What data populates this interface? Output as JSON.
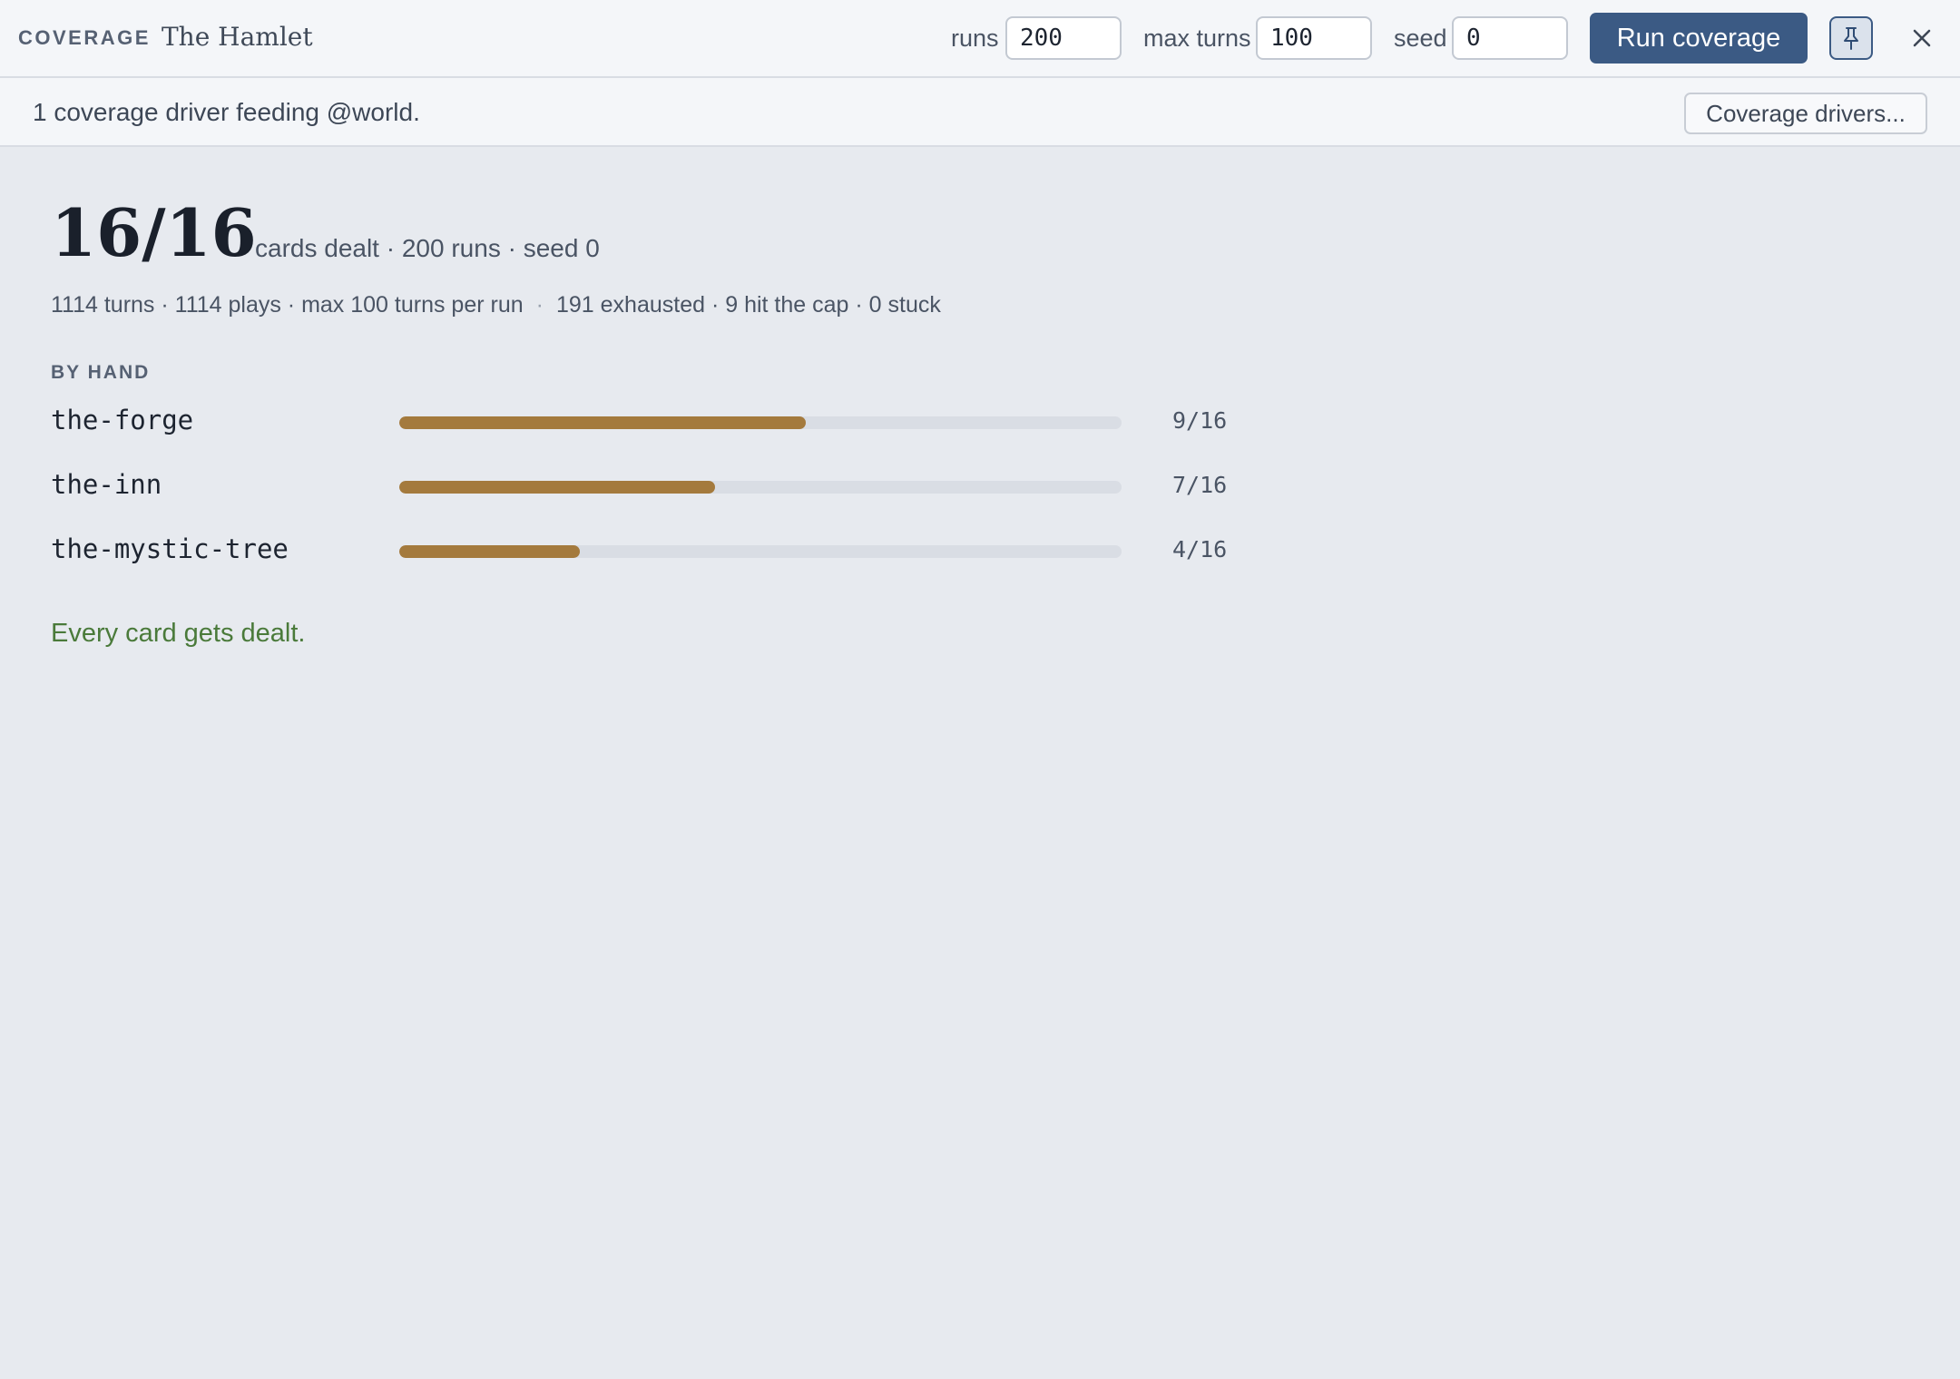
{
  "header": {
    "brand": "COVERAGE",
    "title": "The Hamlet",
    "runs_label": "runs",
    "runs_value": "200",
    "max_turns_label": "max turns",
    "max_turns_value": "100",
    "seed_label": "seed",
    "seed_value": "0",
    "run_button": "Run coverage",
    "pin_icon": "pin-icon",
    "close_icon": "close-icon"
  },
  "subbar": {
    "text": "1 coverage driver feeding @world.",
    "drivers_button": "Coverage drivers..."
  },
  "summary": {
    "count": "16/16",
    "caption": "cards dealt · 200 runs · seed 0",
    "stats_left": "1114 turns · 1114 plays · max 100 turns per run",
    "stats_sep": "·",
    "stats_right": "191 exhausted · 9 hit the cap · 0 stuck"
  },
  "by_hand": {
    "heading": "BY HAND",
    "hands": [
      {
        "name": "the-forge",
        "dealt": 9,
        "total": 16,
        "label": "9/16"
      },
      {
        "name": "the-inn",
        "dealt": 7,
        "total": 16,
        "label": "7/16"
      },
      {
        "name": "the-mystic-tree",
        "dealt": 4,
        "total": 16,
        "label": "4/16"
      }
    ]
  },
  "verdict": "Every card gets dealt.",
  "colors": {
    "accent": "#3b5a84",
    "bar_fill": "#a47a3d",
    "bar_track": "#d9dde4",
    "success": "#4a7a3a"
  }
}
